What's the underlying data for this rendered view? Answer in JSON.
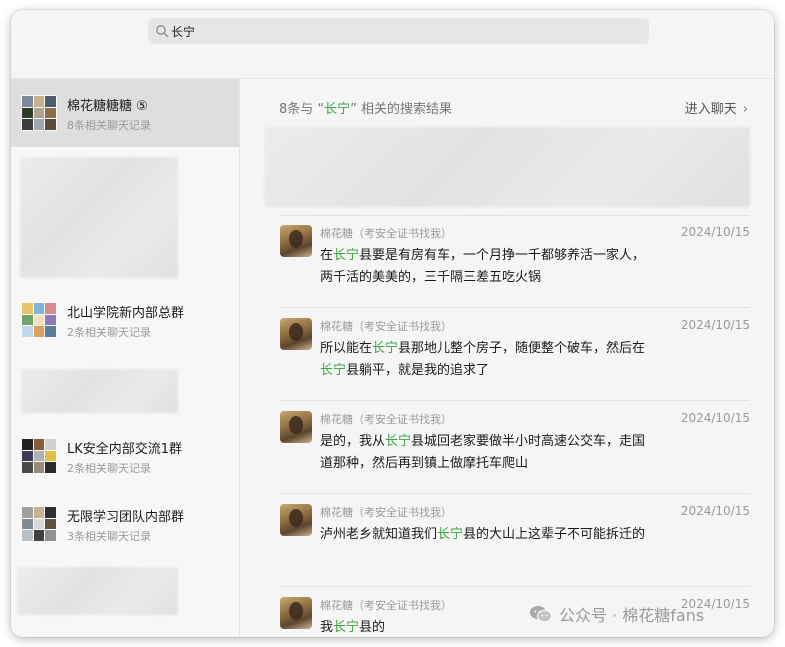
{
  "search": {
    "value": "长宁"
  },
  "sidebar": {
    "items": [
      {
        "title": "棉花糖糖糖 ⑤",
        "subtitle": "8条相关聊天记录"
      },
      {
        "title": "北山学院新内部总群",
        "subtitle": "2条相关聊天记录"
      },
      {
        "title": "LK安全内部交流1群",
        "subtitle": "2条相关聊天记录"
      },
      {
        "title": "无限学习团队内部群",
        "subtitle": "3条相关聊天记录"
      }
    ]
  },
  "main": {
    "result_prefix": "8条与 “",
    "result_keyword": "长宁",
    "result_suffix": "” 相关的搜索结果",
    "enter_chat": "进入聊天",
    "enter_chat_chevron": "›",
    "messages": [
      {
        "sender": "棉花糖（考安全证书找我）",
        "date": "2024/10/15",
        "parts": [
          "在",
          "长宁",
          "县要是有房有车，一个月挣一千都够养活一家人，两千活的美美的，三千隔三差五吃火锅"
        ]
      },
      {
        "sender": "棉花糖（考安全证书找我）",
        "date": "2024/10/15",
        "parts": [
          "所以能在",
          "长宁",
          "县那地儿整个房子，随便整个破车，然后在",
          "长宁",
          "县躺平，就是我的追求了"
        ]
      },
      {
        "sender": "棉花糖（考安全证书找我）",
        "date": "2024/10/15",
        "parts": [
          "是的，我从",
          "长宁",
          "县城回老家要做半小时高速公交车，走国道那种，然后再到镇上做摩托车爬山"
        ]
      },
      {
        "sender": "棉花糖（考安全证书找我）",
        "date": "2024/10/15",
        "parts": [
          "泸州老乡就知道我们",
          "长宁",
          "县的大山上这辈子不可能拆迁的"
        ]
      },
      {
        "sender": "棉花糖（考安全证书找我）",
        "date": "2024/10/15",
        "parts": [
          "我",
          "长宁",
          "县的"
        ]
      }
    ]
  },
  "watermark": {
    "text": "公众号 · 棉花糖fans"
  },
  "colors": {
    "highlight": "#3aa542",
    "active_item": "#dedede"
  }
}
